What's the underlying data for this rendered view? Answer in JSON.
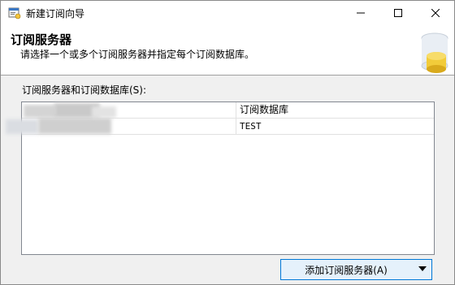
{
  "window": {
    "title": "新建订阅向导"
  },
  "banner": {
    "title": "订阅服务器",
    "subtitle": "请选择一个或多个订阅服务器并指定每个订阅数据库。"
  },
  "grid": {
    "label": "订阅服务器和订阅数据库(S):",
    "columns": [
      "",
      "订阅数据库"
    ],
    "rows": [
      {
        "server": "",
        "database": "TEST"
      }
    ]
  },
  "actions": {
    "add_button": "添加订阅服务器(A)"
  },
  "colors": {
    "button_border": "#0078d7",
    "button_fill": "#e5f1fb",
    "grid_border": "#828790"
  }
}
